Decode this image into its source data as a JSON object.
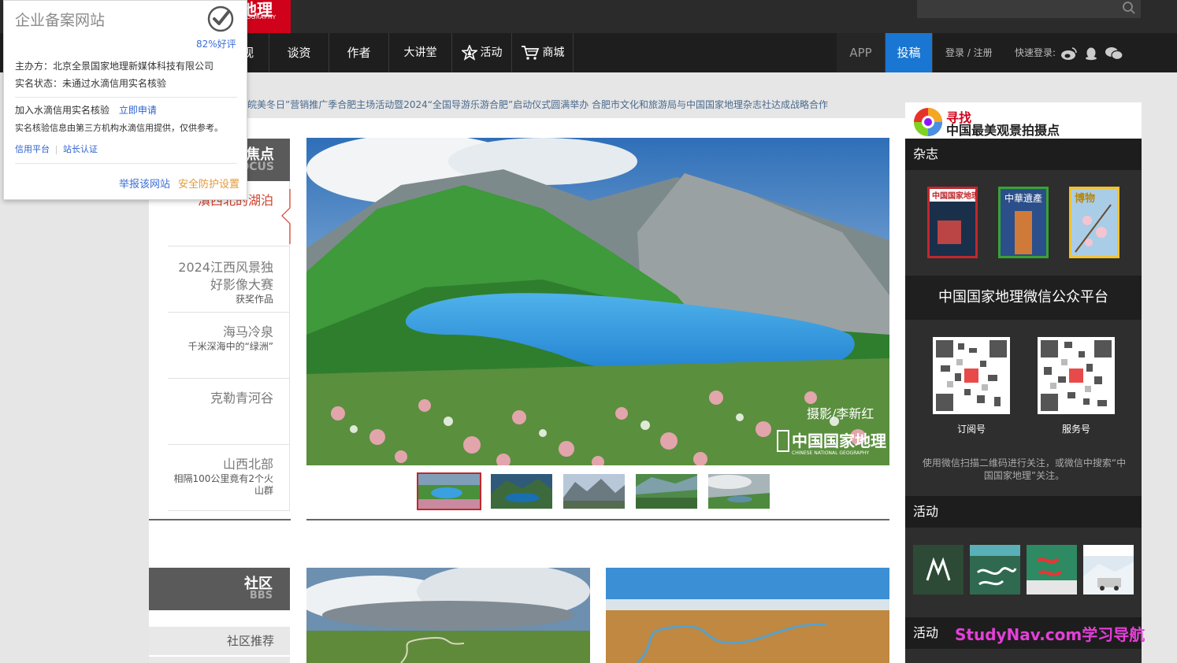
{
  "logo": {
    "line1": "地理",
    "line2": "EOGRAPHY"
  },
  "nav": {
    "items": [
      "视",
      "谈资",
      "作者",
      "大讲堂",
      "活动",
      "商城"
    ],
    "app": "APP",
    "submit": "投稿",
    "login": "登录 / 注册",
    "quick_login": "快速登录:"
  },
  "ticker": "皖美冬日”营销推广季合肥主场活动暨2024“全国导游乐游合肥”启动仪式圆满举办 合肥市文化和旅游局与中国国家地理杂志社达成战略合作",
  "popup": {
    "title": "企业备案网站",
    "rating": "82%好评",
    "sponsor": "主办方：北京全景国家地理新媒体科技有限公司",
    "status": "实名状态：未通过水滴信用实名核验",
    "join": "加入水滴信用实名核验",
    "apply": "立即申请",
    "note": "实名核验信息由第三方机构水滴信用提供，仅供参考。",
    "credit": "信用平台",
    "owner": "站长认证",
    "report": "举报该网站",
    "safety": "安全防护设置"
  },
  "focus": {
    "title_cn": "焦点",
    "title_en": "OCUS"
  },
  "stories": [
    {
      "title": "滇西北的湖泊",
      "sub": ""
    },
    {
      "title": "2024江西风景独好影像大赛",
      "sub": "获奖作品"
    },
    {
      "title": "海马冷泉",
      "sub": "千米深海中的“绿洲”"
    },
    {
      "title": "克勒青河谷",
      "sub": ""
    },
    {
      "title": "山西北部",
      "sub": "相隔100公里竟有2个火山群"
    }
  ],
  "hero": {
    "credit": "摄影/李新红",
    "brand": "中国国家地理",
    "brand_en": "CHINESE NATIONAL GEOGRAPHY"
  },
  "bbs": {
    "title_cn": "社区",
    "title_en": "BBS",
    "recommend": "社区推荐"
  },
  "right": {
    "find1": "寻找",
    "find2": "中国最美观景拍摄点",
    "magazine_head": "杂志",
    "wechat_title": "中国国家地理微信公众平台",
    "qr1": "订阅号",
    "qr2": "服务号",
    "wechat_note": "使用微信扫描二维码进行关注，或微信中搜索“中国国家地理”关注。",
    "activity_head": "活动",
    "activity_head2": "活动"
  },
  "watermark": "StudyNav.com学习导航"
}
